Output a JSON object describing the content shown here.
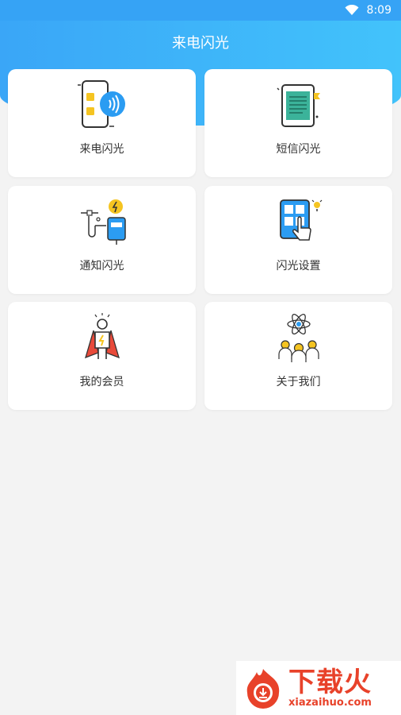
{
  "status_bar": {
    "time": "8:09",
    "icons": [
      "wifi-icon",
      "battery-icon"
    ]
  },
  "header": {
    "title": "来电闪光"
  },
  "menu": {
    "items": [
      {
        "label": "来电闪光",
        "icon": "incoming-call-phone-icon"
      },
      {
        "label": "短信闪光",
        "icon": "sms-document-icon"
      },
      {
        "label": "通知闪光",
        "icon": "notification-power-icon"
      },
      {
        "label": "闪光设置",
        "icon": "settings-tablet-hand-icon"
      },
      {
        "label": "我的会员",
        "icon": "superhero-member-icon"
      },
      {
        "label": "关于我们",
        "icon": "team-atom-icon"
      }
    ]
  },
  "watermark": {
    "brand": "下载火",
    "url": "xiazaihuo.com",
    "color": "#e8422a"
  },
  "colors": {
    "header_start": "#3aa6f7",
    "header_end": "#42c3fb",
    "background": "#f3f3f3",
    "accent": "#2b9cf2",
    "yellow": "#f5c421"
  }
}
